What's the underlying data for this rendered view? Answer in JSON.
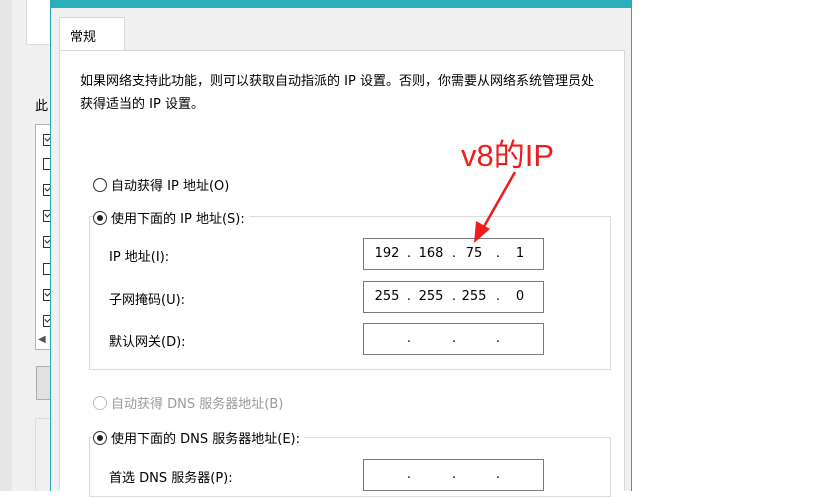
{
  "background_window": {
    "cut_label": "此",
    "group_label": "",
    "checkbox_states": [
      true,
      false,
      true,
      true,
      true,
      false,
      true,
      true
    ]
  },
  "dialog": {
    "tab_label": "常规",
    "description": "如果网络支持此功能，则可以获取自动指派的 IP 设置。否则，你需要从网络系统管理员处获得适当的 IP 设置。",
    "ip_section": {
      "auto_option": "自动获得 IP 地址(O)",
      "manual_option": "使用下面的 IP 地址(S):",
      "selected": "manual",
      "fields": [
        {
          "label": "IP 地址(I):",
          "octets": [
            "192",
            "168",
            "75",
            "1"
          ]
        },
        {
          "label": "子网掩码(U):",
          "octets": [
            "255",
            "255",
            "255",
            "0"
          ]
        },
        {
          "label": "默认网关(D):",
          "octets": [
            "",
            "",
            "",
            ""
          ]
        }
      ]
    },
    "dns_section": {
      "auto_option": "自动获得 DNS 服务器地址(B)",
      "manual_option": "使用下面的 DNS 服务器地址(E):",
      "selected": "manual",
      "fields": [
        {
          "label": "首选 DNS 服务器(P):",
          "octets": [
            "",
            "",
            "",
            ""
          ]
        }
      ]
    }
  },
  "annotation": {
    "text": "v8的IP",
    "color": "#ee1c1c"
  },
  "colors": {
    "titlebar": "#2ab0bd",
    "dialog_bg": "#f0f0f0",
    "panel_bg": "#ffffff",
    "input_border": "#7a7a7a"
  }
}
